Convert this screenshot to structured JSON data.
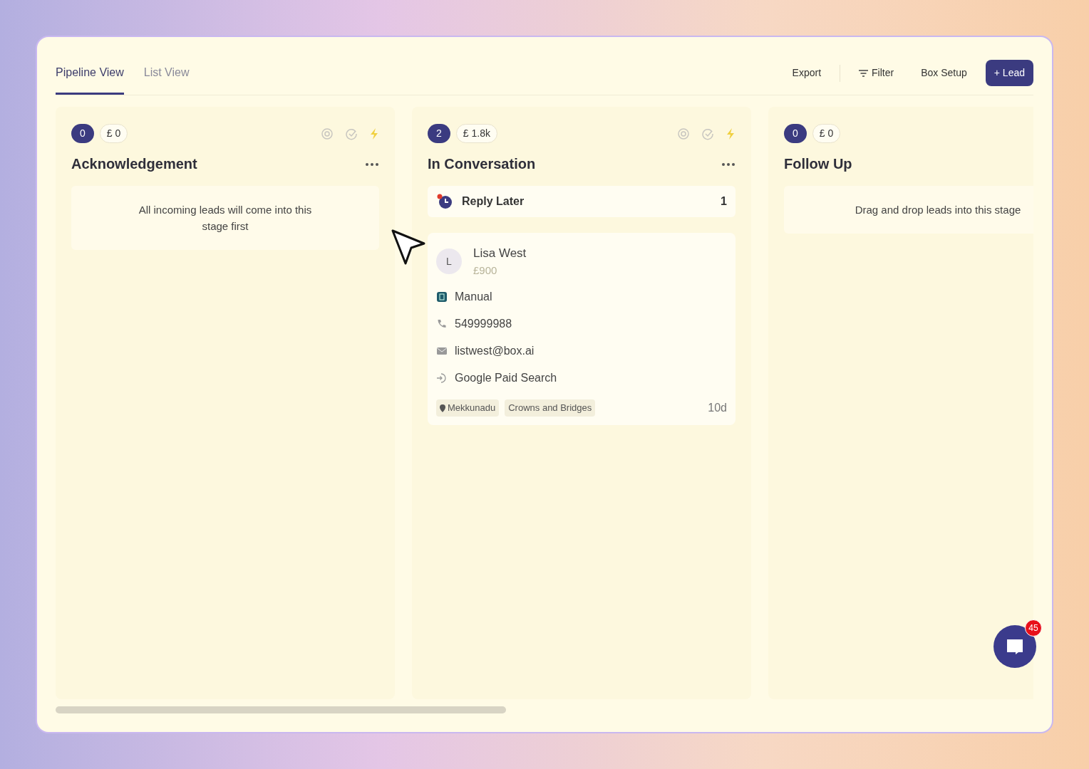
{
  "tabs": [
    {
      "label": "Pipeline View",
      "selected": true
    },
    {
      "label": "List View",
      "selected": false
    }
  ],
  "toolbar": [
    {
      "label": "Export",
      "kind": "plain"
    },
    {
      "label": "Filter",
      "kind": "filter"
    },
    {
      "label": "Box Setup",
      "kind": "plain"
    },
    {
      "label": "+ Lead",
      "kind": "primary"
    }
  ],
  "columns": [
    {
      "count": "0",
      "amount": "£ 0",
      "title": "Acknowledgement",
      "show_tools": true,
      "empty_message": "All incoming leads will come into this stage first"
    },
    {
      "count": "2",
      "amount": "£ 1.8k",
      "title": "In Conversation",
      "show_tools": true,
      "groups": [
        {
          "label": "Reply Later",
          "count": "1",
          "unread": true
        }
      ],
      "leads": [
        {
          "initial": "L",
          "name": "Lisa West",
          "value": "£900",
          "source": "Manual",
          "phone": "549999988",
          "email": "listwest@box.ai",
          "channel": "Google Paid Search",
          "tags": [
            {
              "text": "Mekkunadu",
              "kind": "location"
            },
            {
              "text": "Crowns and Bridges",
              "kind": "plain"
            }
          ],
          "age": "10d"
        }
      ]
    },
    {
      "count": "0",
      "amount": "£ 0",
      "title": "Follow Up",
      "empty_message": "Drag and drop leads into this stage"
    }
  ],
  "chat": {
    "badge": "45"
  }
}
